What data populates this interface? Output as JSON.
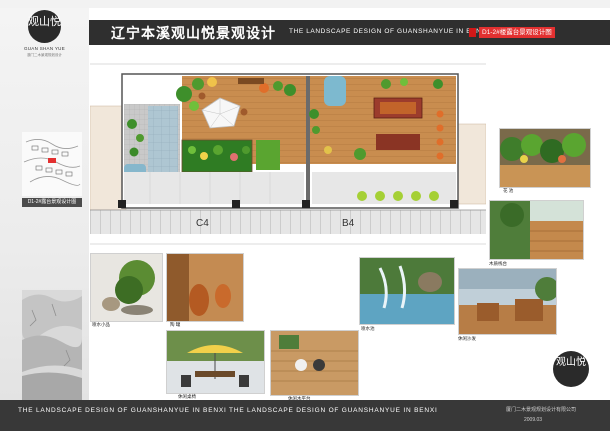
{
  "header": {
    "title_cn": "辽宁本溪观山悦景观设计",
    "title_en": "THE LANDSCAPE DESIGN OF GUANSHANYUE IN BENXI",
    "sheet_title": "D1-2#楼露台景观设计图"
  },
  "logo": {
    "characters": "观山悦",
    "name_en": "GUAN SHAN YUE",
    "tagline": "澳门二木景观规划设计"
  },
  "sidebar": {
    "map_label": "D1-2#露台景观设计图"
  },
  "plan": {
    "labels": [
      "C4",
      "B4"
    ]
  },
  "photos": [
    {
      "caption": "花 池"
    },
    {
      "caption": "木质栈台"
    },
    {
      "caption": "喷水小品"
    },
    {
      "caption": "陶 罐"
    },
    {
      "caption": "休闲桌椅"
    },
    {
      "caption": "休闲木平台"
    },
    {
      "caption": "喷水池"
    },
    {
      "caption": "休闲沙发"
    }
  ],
  "footer": {
    "text": "THE LANDSCAPE DESIGN OF GUANSHANYUE IN BENXI  THE LANDSCAPE DESIGN OF GUANSHANYUE IN BENXI",
    "company": "厦门二木景观规划设计有限公司",
    "date": "2009.03"
  },
  "colors": {
    "header_bg": "#2f2f2f",
    "footer_bg": "#383838",
    "accent_red": "#e33030",
    "deck_wood": "#c88d4e",
    "tile_blue": "#a9c3cf",
    "planting_green": "#4f9a2e"
  }
}
